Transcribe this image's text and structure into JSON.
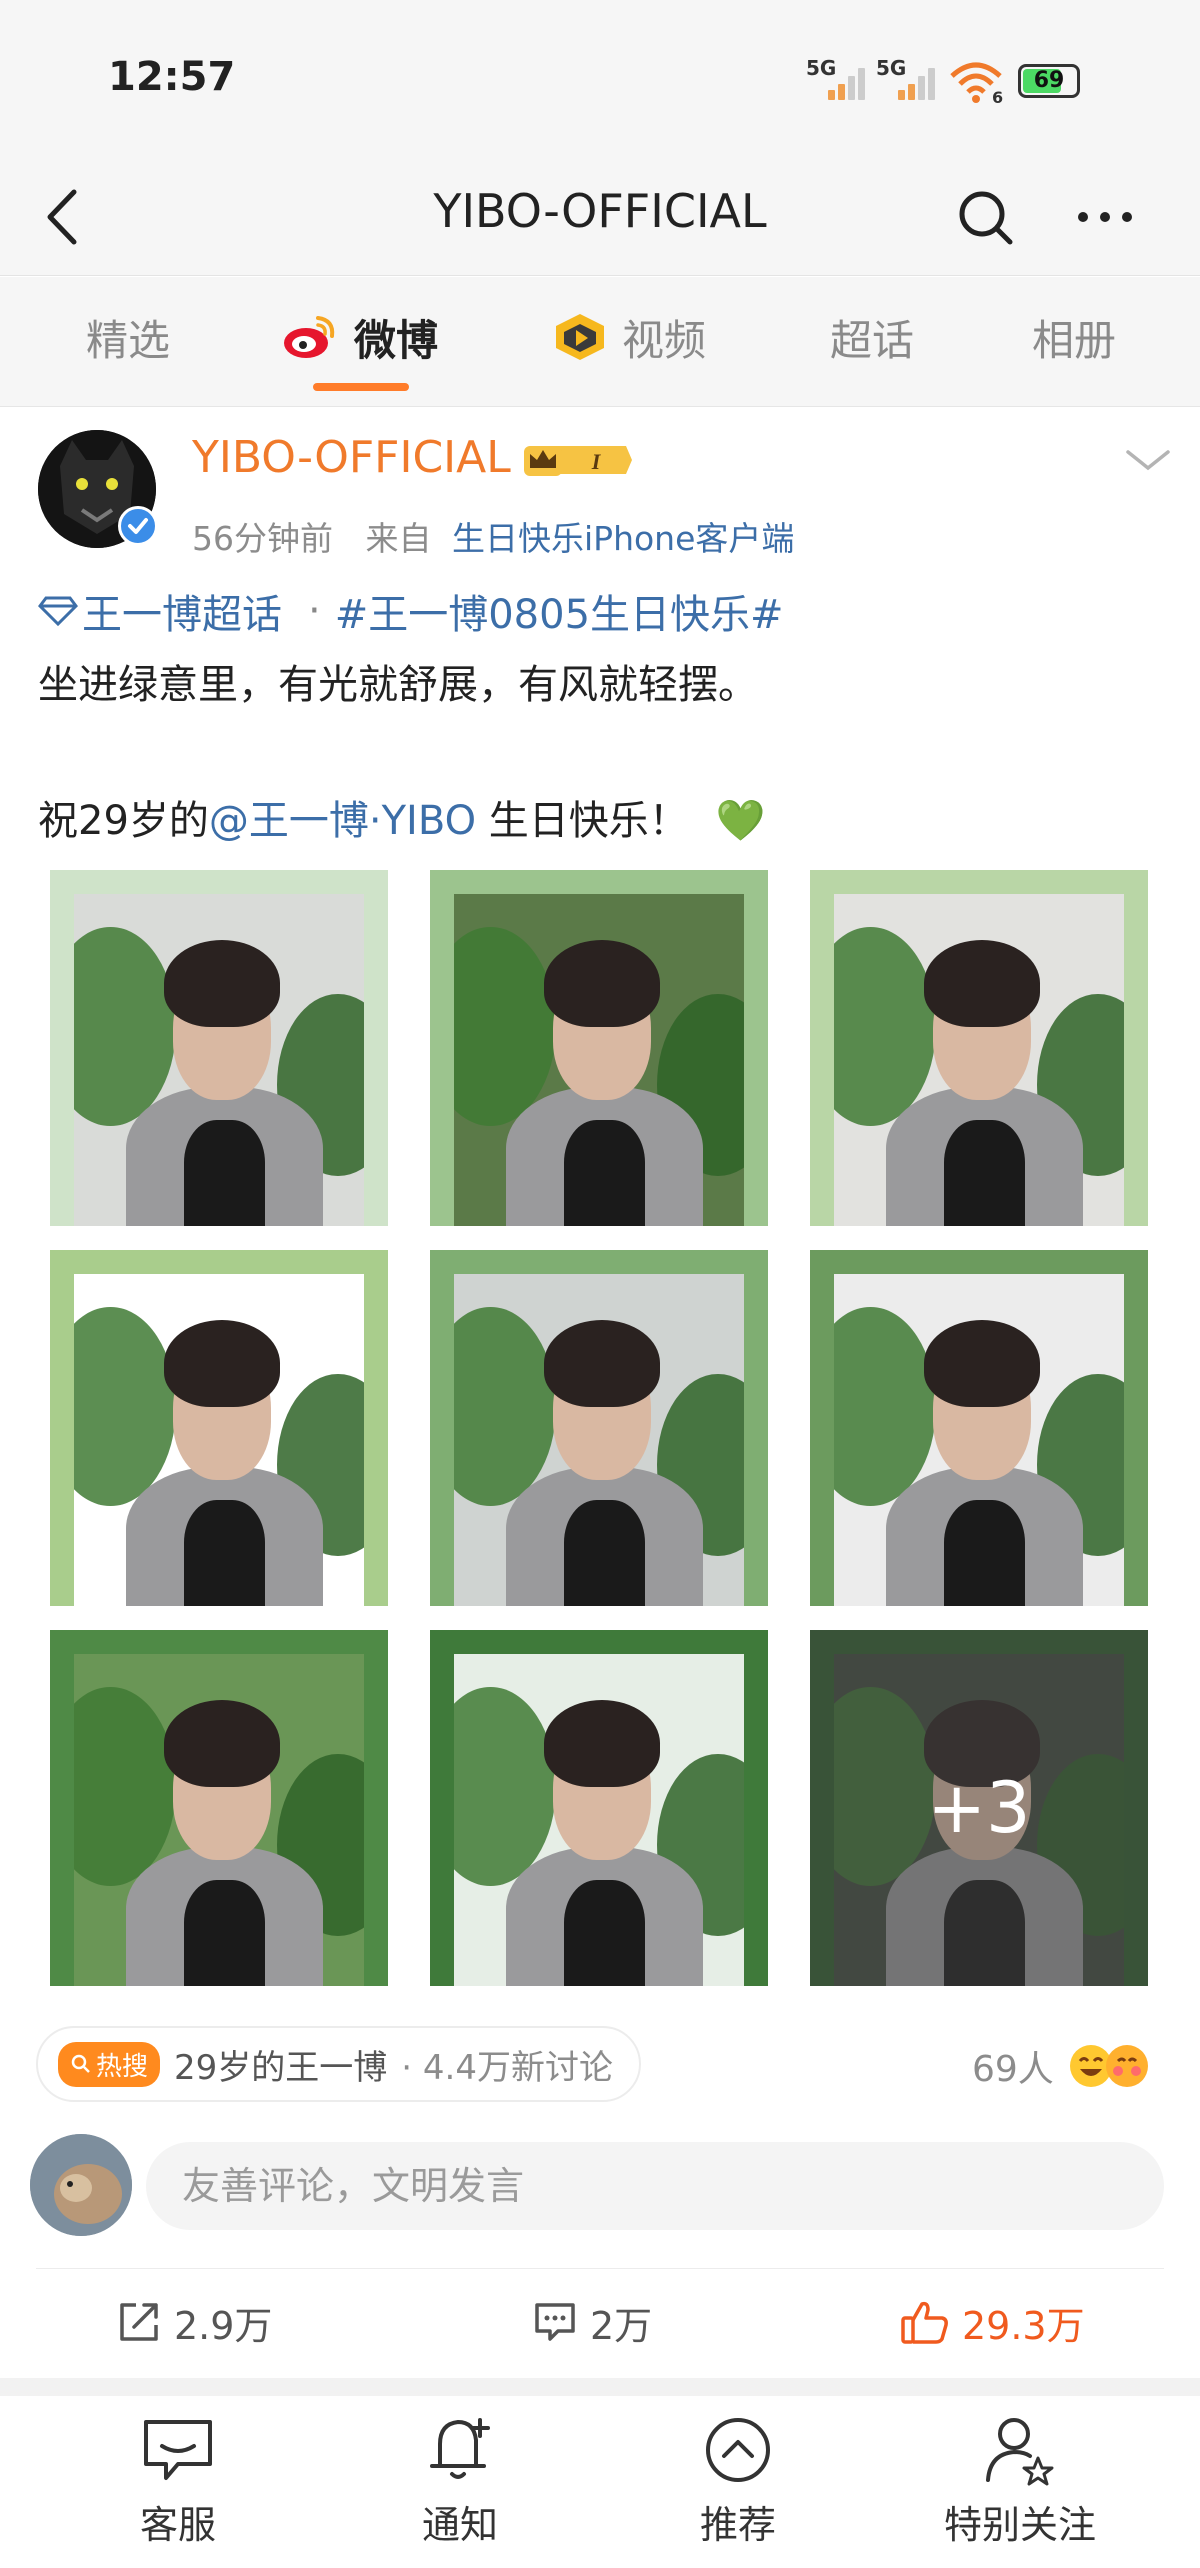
{
  "status_bar": {
    "time": "12:57",
    "signal1_label": "5G",
    "signal2_label": "5G",
    "wifi_label": "6",
    "battery": "69",
    "battery_level": 0.69
  },
  "nav": {
    "title": "YIBO-OFFICIAL",
    "back_icon": "back-arrow-icon",
    "search_icon": "search-icon",
    "more_icon": "more-dots-icon"
  },
  "tabs": [
    {
      "label": "精选",
      "active": false
    },
    {
      "label": "微博",
      "active": true,
      "icon": "weibo-logo-icon"
    },
    {
      "label": "视频",
      "active": false,
      "icon": "video-play-icon"
    },
    {
      "label": "超话",
      "active": false
    },
    {
      "label": "相册",
      "active": false
    }
  ],
  "post": {
    "username": "YIBO-OFFICIAL",
    "badge_level": "I",
    "time_ago": "56分钟前",
    "from_prefix": "来自",
    "source": "生日快乐iPhone客户端",
    "topic_super": "王一博超话",
    "topic_sep": "·",
    "hashtag": "#王一博0805生日快乐#",
    "text_line1": "坐进绿意里，有光就舒展，有风就轻摆。",
    "text_line2_prefix": "祝29岁的",
    "mention": "@王一博·YIBO",
    "text_line2_suffix": " 生日快乐！",
    "emoji_heart": "💚",
    "more_photos_label": "+3"
  },
  "colors": {
    "accent_orange": "#f07a2b",
    "link_blue": "#3c6ea8",
    "like_orange": "#f05a1e",
    "frame_greens": [
      "#cfe3c9",
      "#9cc48e",
      "#b9d6a6",
      "#a9cd8c",
      "#7fae72",
      "#6c9b5e",
      "#4f8a46",
      "#3f7a3a",
      "#2f5e2c"
    ]
  },
  "hot_search": {
    "tag": "热搜",
    "title": "29岁的王一博",
    "sub": "· 4.4万新讨论"
  },
  "likers": {
    "count": "69人"
  },
  "comment": {
    "placeholder": "友善评论，文明发言"
  },
  "actions": {
    "repost": "2.9万",
    "comments": "2万",
    "likes": "29.3万"
  },
  "bottom_bar": [
    {
      "label": "客服",
      "icon": "chat-bubble-icon"
    },
    {
      "label": "通知",
      "icon": "bell-add-icon"
    },
    {
      "label": "推荐",
      "icon": "chevron-up-circle-icon"
    },
    {
      "label": "特别关注",
      "icon": "user-star-icon"
    }
  ]
}
